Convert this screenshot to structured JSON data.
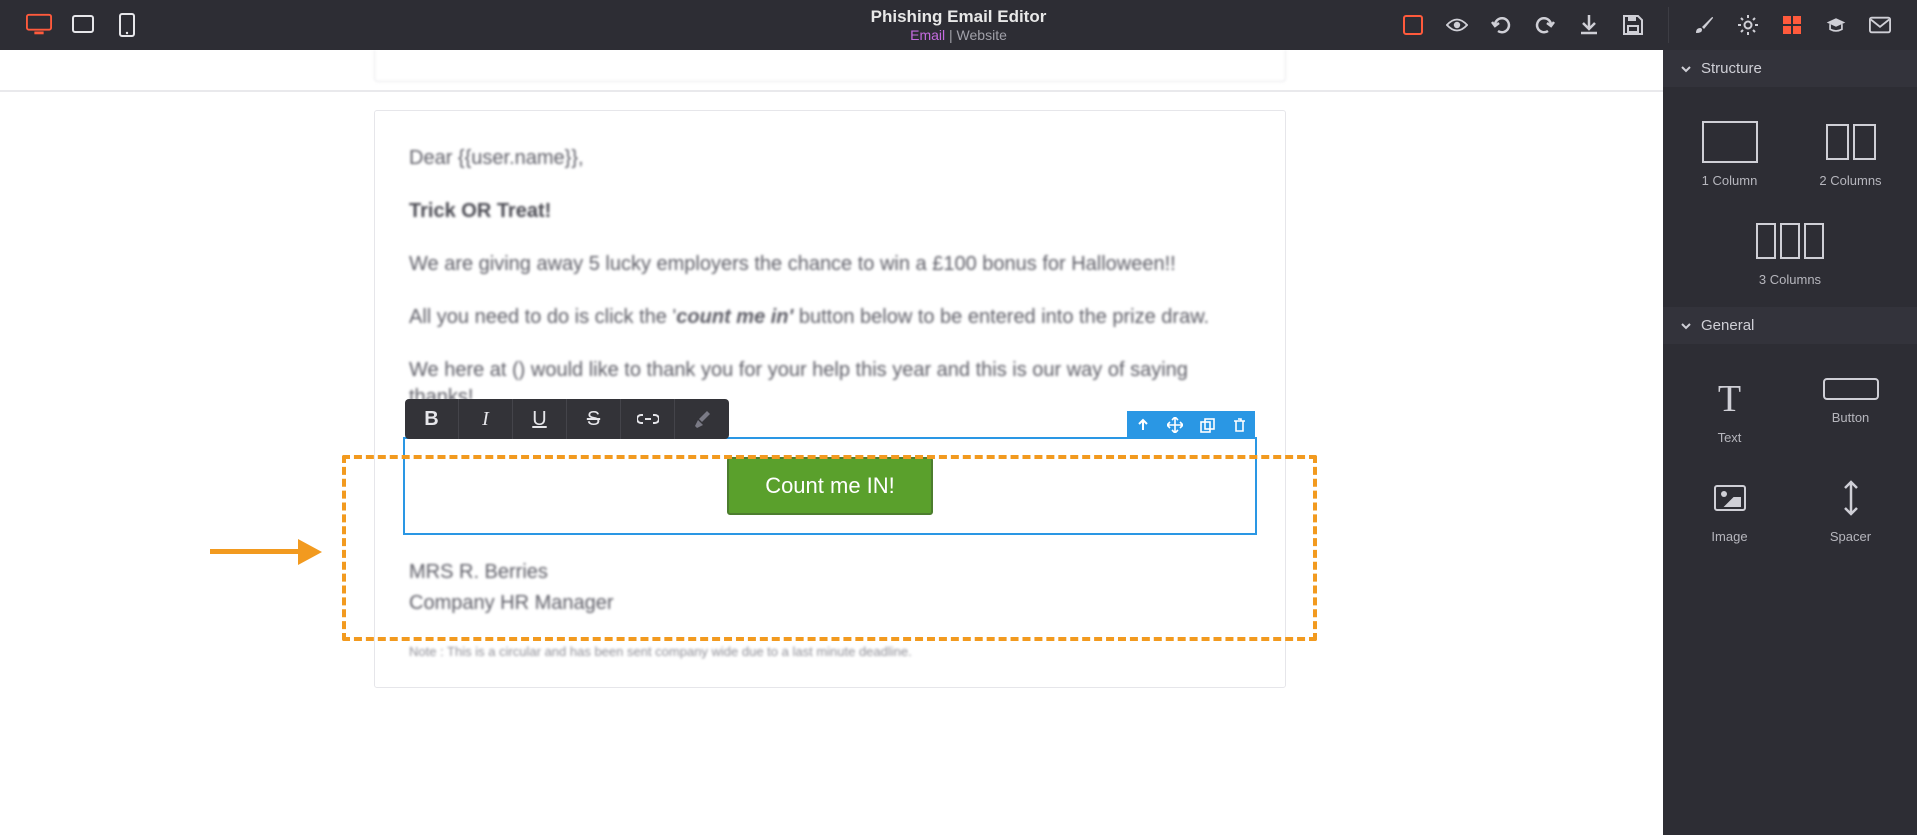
{
  "header": {
    "title": "Phishing Email Editor",
    "subtitle_email": "Email",
    "subtitle_sep": " | ",
    "subtitle_web": "Website"
  },
  "email": {
    "greeting": "Dear {{user.name}},",
    "headline": "Trick OR Treat!",
    "line1": "We are giving away 5 lucky employers the chance to win a £100 bonus for Halloween!!",
    "line2_a": "All you need to do is click the '",
    "line2_em": "count me in'",
    "line2_b": " button below to be entered into the prize draw.",
    "line3": "We here at () would like to thank you for your help this year and this is our way of saying thanks!",
    "cta_label": "Count me IN!",
    "sig_name": "MRS R. Berries",
    "sig_title": "Company HR Manager",
    "footnote": "Note : This is a circular and has been sent company wide due to a last minute deadline."
  },
  "format_toolbar": {
    "bold": "B",
    "italic": "I",
    "underline": "U",
    "strike": "S"
  },
  "sidepanel": {
    "section_structure": "Structure",
    "section_general": "General",
    "items": {
      "col1": "1 Column",
      "col2": "2 Columns",
      "col3": "3 Columns",
      "text": "Text",
      "button": "Button",
      "image": "Image",
      "spacer": "Spacer"
    }
  }
}
